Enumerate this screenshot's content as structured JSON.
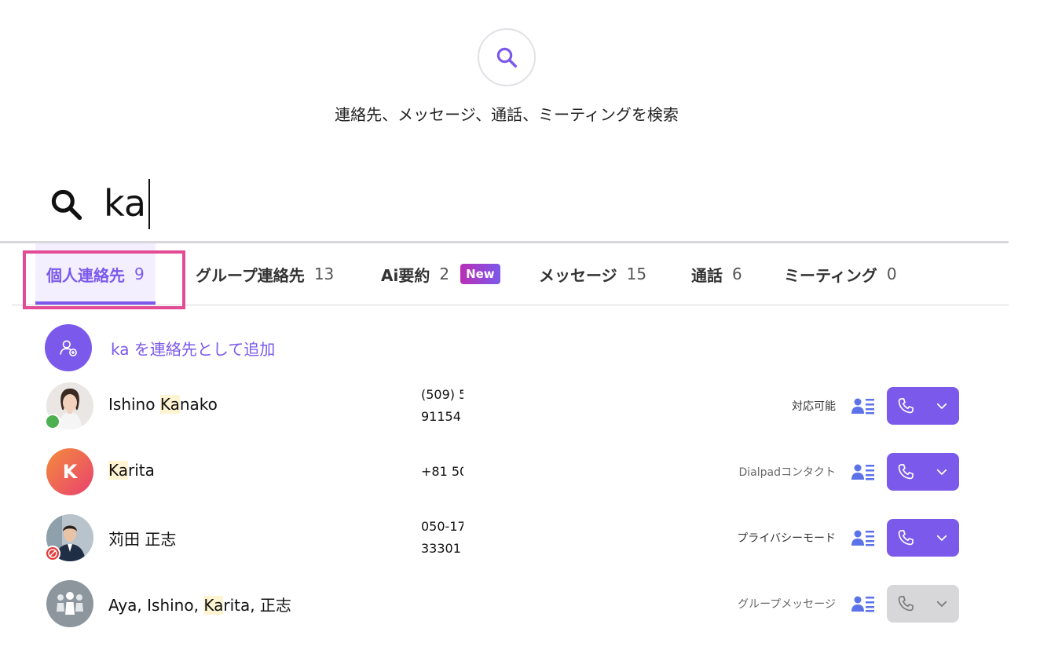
{
  "header": {
    "hint": "連絡先、メッセージ、通話、ミーティングを検索"
  },
  "search": {
    "value": "ka"
  },
  "tabs": [
    {
      "label": "個人連絡先",
      "count": "9"
    },
    {
      "label": "グループ連絡先",
      "count": "13"
    },
    {
      "label": "Ai要約",
      "count": "2",
      "badge": "New"
    },
    {
      "label": "メッセージ",
      "count": "15"
    },
    {
      "label": "通話",
      "count": "6"
    },
    {
      "label": "ミーティング",
      "count": "0"
    }
  ],
  "add_contact": {
    "label": "ka を連絡先として追加"
  },
  "results": [
    {
      "name_pre": "Ishino ",
      "name_hl": "Ka",
      "name_post": "nako",
      "phone_line1": "(509) 5",
      "phone_line2": "91154",
      "status": "対応可能",
      "presence": "available",
      "avatar": "photo-woman"
    },
    {
      "name_pre": "",
      "name_hl": "Ka",
      "name_post": "rita",
      "phone_line1": "+81 50",
      "phone_line2": "",
      "status": "Dialpadコンタクト",
      "avatar_initial": "K"
    },
    {
      "name_pre": "苅田 正志",
      "name_hl": "",
      "name_post": "",
      "phone_line1": "050-17",
      "phone_line2": "33301",
      "status": "プライバシーモード",
      "presence": "do-not-disturb",
      "avatar": "photo-man"
    },
    {
      "name_pre": "Aya, Ishino, ",
      "name_hl": "Ka",
      "name_post": "rita, 正志",
      "phone_line1": "",
      "phone_line2": "",
      "status": "グループメッセージ",
      "avatar": "group-icon",
      "call_disabled": true
    }
  ],
  "colors": {
    "accent": "#7b59ea",
    "highlight": "#fff4d1",
    "tab_focus_border": "#e24c95",
    "available": "#4caf50",
    "dnd": "#e53935"
  }
}
